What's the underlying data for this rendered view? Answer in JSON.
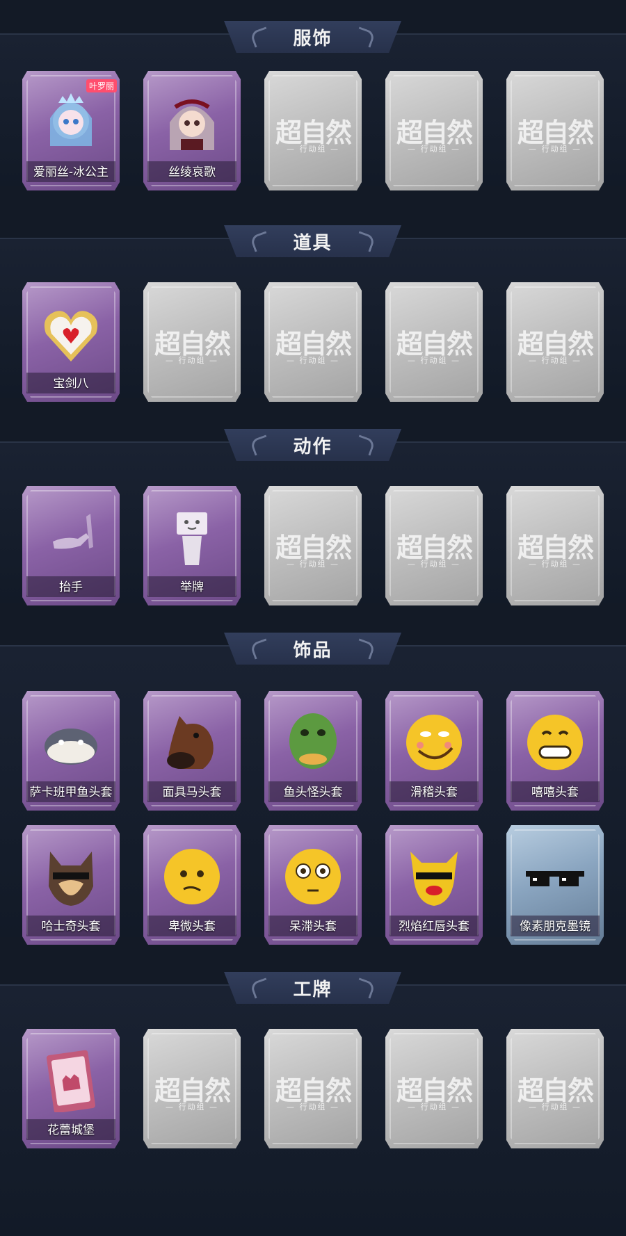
{
  "sections": [
    {
      "title": "服饰",
      "rows": [
        [
          {
            "type": "purple",
            "label": "爱丽丝-冰公主",
            "badge": "叶罗丽",
            "icon": "princess-avatar-icon"
          },
          {
            "type": "purple",
            "label": "丝绫哀歌",
            "icon": "gothic-doll-avatar-icon"
          },
          {
            "type": "empty"
          },
          {
            "type": "empty"
          },
          {
            "type": "empty"
          }
        ]
      ]
    },
    {
      "title": "道具",
      "rows": [
        [
          {
            "type": "purple",
            "label": "宝剑八",
            "icon": "heart-locket-icon"
          },
          {
            "type": "empty"
          },
          {
            "type": "empty"
          },
          {
            "type": "empty"
          },
          {
            "type": "empty"
          }
        ]
      ]
    },
    {
      "title": "动作",
      "rows": [
        [
          {
            "type": "purple",
            "label": "抬手",
            "icon": "raised-hand-icon"
          },
          {
            "type": "purple",
            "label": "举牌",
            "icon": "hold-sign-icon"
          },
          {
            "type": "empty"
          },
          {
            "type": "empty"
          },
          {
            "type": "empty"
          }
        ]
      ]
    },
    {
      "title": "饰品",
      "rows": [
        [
          {
            "type": "purple",
            "label": "萨卡班甲鱼头套",
            "icon": "fish-head-icon"
          },
          {
            "type": "purple",
            "label": "面具马头套",
            "icon": "horse-head-icon"
          },
          {
            "type": "purple",
            "label": "鱼头怪头套",
            "icon": "green-fish-face-icon"
          },
          {
            "type": "purple",
            "label": "滑稽头套",
            "icon": "funny-face-icon"
          },
          {
            "type": "purple",
            "label": "嘻嘻头套",
            "icon": "grin-face-icon"
          }
        ],
        [
          {
            "type": "purple",
            "label": "哈士奇头套",
            "icon": "husky-head-icon"
          },
          {
            "type": "purple",
            "label": "卑微头套",
            "icon": "humble-face-icon"
          },
          {
            "type": "purple",
            "label": "呆滞头套",
            "icon": "blank-stare-face-icon"
          },
          {
            "type": "purple",
            "label": "烈焰红唇头套",
            "icon": "yellow-mask-red-lips-icon"
          },
          {
            "type": "blue",
            "label": "像素朋克墨镜",
            "icon": "pixel-sunglasses-icon"
          }
        ]
      ]
    },
    {
      "title": "工牌",
      "rows": [
        [
          {
            "type": "purple",
            "label": "花蕾城堡",
            "icon": "castle-card-icon"
          },
          {
            "type": "empty"
          },
          {
            "type": "empty"
          },
          {
            "type": "empty"
          },
          {
            "type": "empty"
          }
        ]
      ]
    }
  ],
  "placeholder": {
    "watermark": "超自然",
    "watermark_sub": "— 行动组 —"
  },
  "colors": {
    "background": "#131a26",
    "header": "#2c3752",
    "card_purple": "#8a62a6",
    "card_blue": "#8aa5c0",
    "card_empty": "#bdbdbd"
  }
}
